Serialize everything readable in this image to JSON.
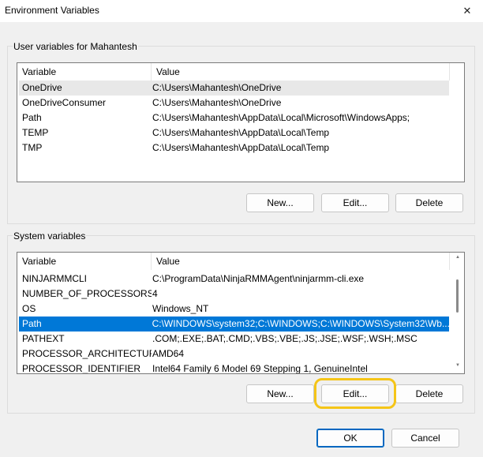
{
  "window": {
    "title": "Environment Variables"
  },
  "user_vars": {
    "group_label": "User variables for Mahantesh",
    "columns": [
      "Variable",
      "Value"
    ],
    "rows": [
      {
        "variable": "OneDrive",
        "value": "C:\\Users\\Mahantesh\\OneDrive"
      },
      {
        "variable": "OneDriveConsumer",
        "value": "C:\\Users\\Mahantesh\\OneDrive"
      },
      {
        "variable": "Path",
        "value": "C:\\Users\\Mahantesh\\AppData\\Local\\Microsoft\\WindowsApps;"
      },
      {
        "variable": "TEMP",
        "value": "C:\\Users\\Mahantesh\\AppData\\Local\\Temp"
      },
      {
        "variable": "TMP",
        "value": "C:\\Users\\Mahantesh\\AppData\\Local\\Temp"
      }
    ],
    "buttons": {
      "new": "New...",
      "edit": "Edit...",
      "delete": "Delete"
    }
  },
  "system_vars": {
    "group_label": "System variables",
    "columns": [
      "Variable",
      "Value"
    ],
    "rows": [
      {
        "variable": "NINJARMMCLI",
        "value": "C:\\ProgramData\\NinjaRMMAgent\\ninjarmm-cli.exe"
      },
      {
        "variable": "NUMBER_OF_PROCESSORS",
        "value": "4"
      },
      {
        "variable": "OS",
        "value": "Windows_NT"
      },
      {
        "variable": "Path",
        "value": "C:\\WINDOWS\\system32;C:\\WINDOWS;C:\\WINDOWS\\System32\\Wb..."
      },
      {
        "variable": "PATHEXT",
        "value": ".COM;.EXE;.BAT;.CMD;.VBS;.VBE;.JS;.JSE;.WSF;.WSH;.MSC"
      },
      {
        "variable": "PROCESSOR_ARCHITECTURE",
        "value": "AMD64"
      },
      {
        "variable": "PROCESSOR_IDENTIFIER",
        "value": "Intel64 Family 6 Model 69 Stepping 1, GenuineIntel"
      }
    ],
    "selected_row": "Path",
    "buttons": {
      "new": "New...",
      "edit": "Edit...",
      "delete": "Delete"
    }
  },
  "footer": {
    "ok": "OK",
    "cancel": "Cancel"
  },
  "colors": {
    "selection": "#0078d7",
    "highlight_ring": "#f5c518",
    "default_border": "#0067c0"
  }
}
